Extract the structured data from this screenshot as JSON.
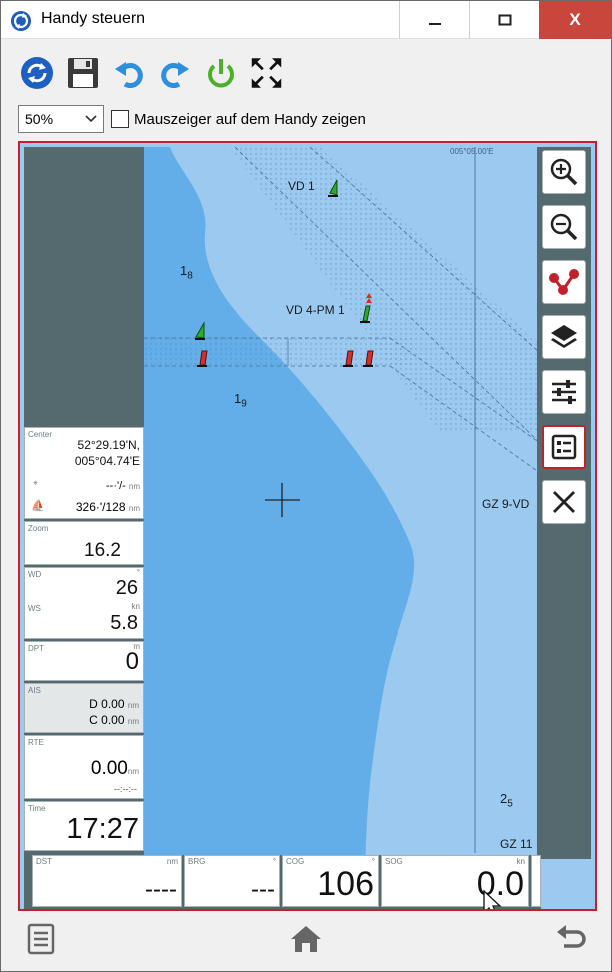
{
  "window": {
    "title": "Handy steuern",
    "minimize_glyph": "—",
    "maximize_glyph": "☐",
    "close_glyph": "X"
  },
  "toolbar": {
    "icons": [
      "refresh-icon",
      "save-icon",
      "undo-icon",
      "redo-icon",
      "power-icon",
      "fullscreen-icon"
    ]
  },
  "zoom": {
    "value": "50%"
  },
  "pointer_option": {
    "label": "Mauszeiger auf dem Handy zeigen",
    "checked": false
  },
  "map": {
    "longitude_label": "005°05.00'E",
    "labels": {
      "vd1": "VD 1",
      "vd4": "VD 4-PM 1",
      "gz9": "GZ 9-VD",
      "gz11": "GZ 11"
    },
    "depths": [
      {
        "main": "1",
        "sub": "8"
      },
      {
        "main": "1",
        "sub": "9"
      },
      {
        "main": "2",
        "sub": "5"
      }
    ],
    "colors": {
      "sea_shallow": "#63aee8",
      "sea_deep": "#9cc9ef",
      "land": "#556a6f",
      "buoy_green": "#2faa2f",
      "buoy_red": "#d0312d"
    }
  },
  "instruments": {
    "center": {
      "label": "Center",
      "lat": "52°29.19'N,",
      "lon": "005°04.74'E",
      "dist": "--·'/-",
      "dist_unit": "nm",
      "boat": "326·'/128",
      "boat_unit": "nm"
    },
    "zoom": {
      "label": "Zoom",
      "value": "16.2"
    },
    "wind": {
      "wd_label": "WD",
      "wd": "26",
      "wd_unit": "°",
      "ws_label": "WS",
      "ws": "5.8",
      "ws_unit": "kn"
    },
    "dpt": {
      "label": "DPT",
      "value": "0",
      "unit": "m"
    },
    "ais": {
      "label": "AIS",
      "d_label": "D",
      "d": "0.00",
      "c_label": "C",
      "c": "0.00",
      "unit": "nm"
    },
    "rte": {
      "label": "RTE",
      "value": "0.00",
      "unit": "nm",
      "eta": "--:--:--"
    },
    "time": {
      "label": "Time",
      "value": "17:27"
    }
  },
  "bottom": [
    {
      "label": "DST",
      "unit": "nm",
      "value": "----"
    },
    {
      "label": "BRG",
      "unit": "°",
      "value": "---"
    },
    {
      "label": "COG",
      "unit": "°",
      "value": "106"
    },
    {
      "label": "SOG",
      "unit": "kn",
      "value": "0.0"
    }
  ],
  "sidebar_buttons": [
    "zoom-in-icon",
    "zoom-out-icon",
    "route-icon",
    "layers-icon",
    "settings-icon",
    "dashboard-icon",
    "close-icon"
  ],
  "footer": {
    "icons": [
      "menu-icon",
      "home-icon",
      "back-icon"
    ]
  }
}
